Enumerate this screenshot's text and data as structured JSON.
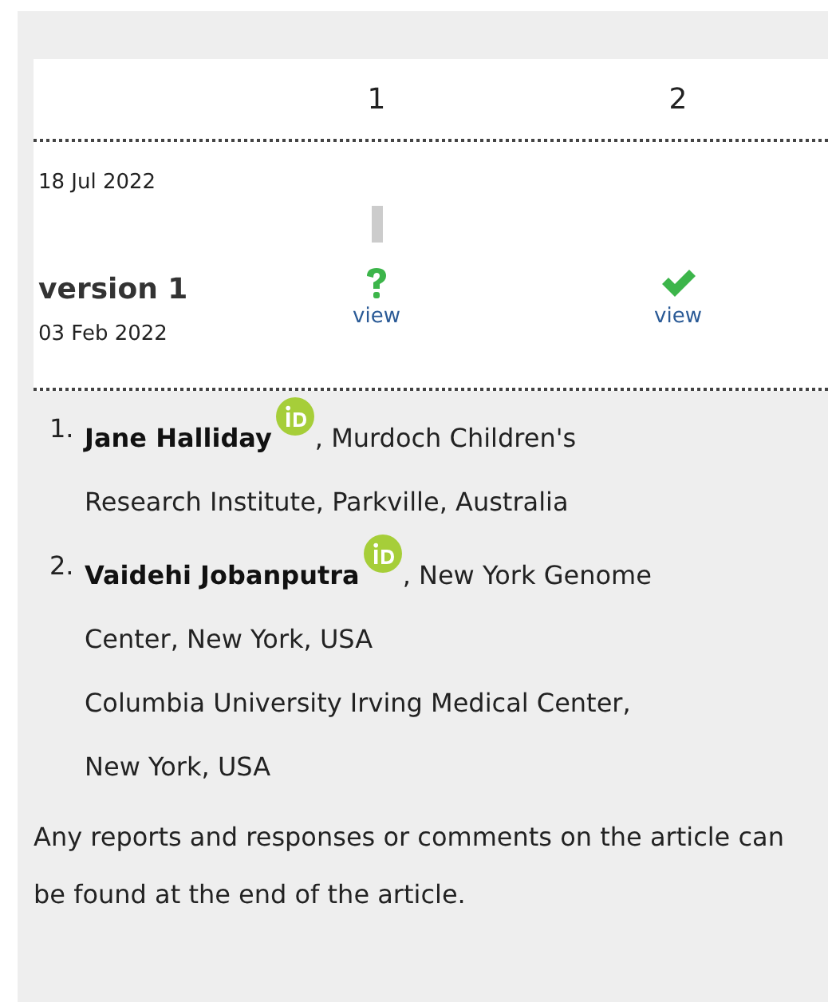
{
  "reviewers": [
    {
      "label": "1"
    },
    {
      "label": "2"
    }
  ],
  "revision_date": "18 Jul 2022",
  "versions": [
    {
      "title": "version 1",
      "date": "03 Feb 2022",
      "reports": [
        {
          "kind": "question",
          "connector": true,
          "link": "view"
        },
        {
          "kind": "approved",
          "connector": false,
          "link": "view"
        }
      ]
    }
  ],
  "authors": [
    {
      "number": "1.",
      "name": "Jane Halliday",
      "orcid": true,
      "affiliations": [
        ", Murdoch Children's",
        "Research Institute, Parkville, Australia"
      ]
    },
    {
      "number": "2.",
      "name": "Vaidehi Jobanputra",
      "orcid": true,
      "affiliations": [
        ", New York Genome",
        "Center, New York, USA",
        "Columbia University Irving Medical Center,",
        "New York, USA"
      ]
    }
  ],
  "note": "Any reports and responses or comments on the article can be found at the end of the article."
}
